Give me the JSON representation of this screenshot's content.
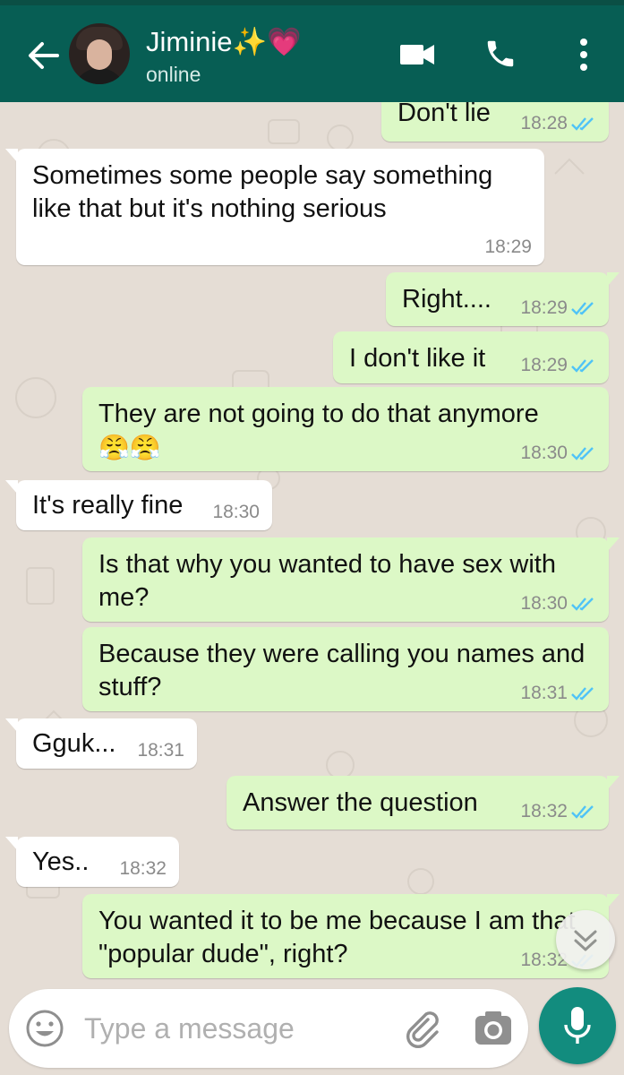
{
  "header": {
    "contact_name": "Jiminie✨💗",
    "status": "online"
  },
  "messages": [
    {
      "dir": "out",
      "text": "Don't lie",
      "time": "18:28",
      "read": true
    },
    {
      "dir": "in",
      "text": "Sometimes some people say something like that but it's nothing serious",
      "time": "18:29"
    },
    {
      "dir": "out",
      "text": "Right....",
      "time": "18:29",
      "read": true
    },
    {
      "dir": "out",
      "text": "I don't like it",
      "time": "18:29",
      "read": true
    },
    {
      "dir": "out",
      "text": "They are not going to do that anymore",
      "emoji": "😤😤",
      "time": "18:30",
      "read": true
    },
    {
      "dir": "in",
      "text": "It's really fine",
      "time": "18:30"
    },
    {
      "dir": "out",
      "text": "Is that why you wanted to have sex with me?",
      "time": "18:30",
      "read": true
    },
    {
      "dir": "out",
      "text": "Because they were calling you names and stuff?",
      "time": "18:31",
      "read": true
    },
    {
      "dir": "in",
      "text": "Gguk...",
      "time": "18:31"
    },
    {
      "dir": "out",
      "text": "Answer the question",
      "time": "18:32",
      "read": true
    },
    {
      "dir": "in",
      "text": "Yes..",
      "time": "18:32"
    },
    {
      "dir": "out",
      "text": "You wanted it to be me because I am that \"popular dude\", right?",
      "time": "18:32",
      "read": true
    }
  ],
  "composer": {
    "placeholder": "Type a message"
  },
  "colors": {
    "header": "#075e54",
    "outgoing_bubble": "#dcf8c6",
    "incoming_bubble": "#ffffff",
    "chat_background": "#e5ddd5",
    "read_ticks": "#4fc3f7",
    "mic_button": "#128c7e"
  },
  "icons": {
    "back": "arrow-left-icon",
    "video": "video-camera-icon",
    "call": "phone-icon",
    "menu": "more-vert-icon",
    "emoji": "smiley-icon",
    "attach": "paperclip-icon",
    "camera": "camera-icon",
    "mic": "microphone-icon",
    "scroll_down": "double-chevron-down-icon"
  }
}
